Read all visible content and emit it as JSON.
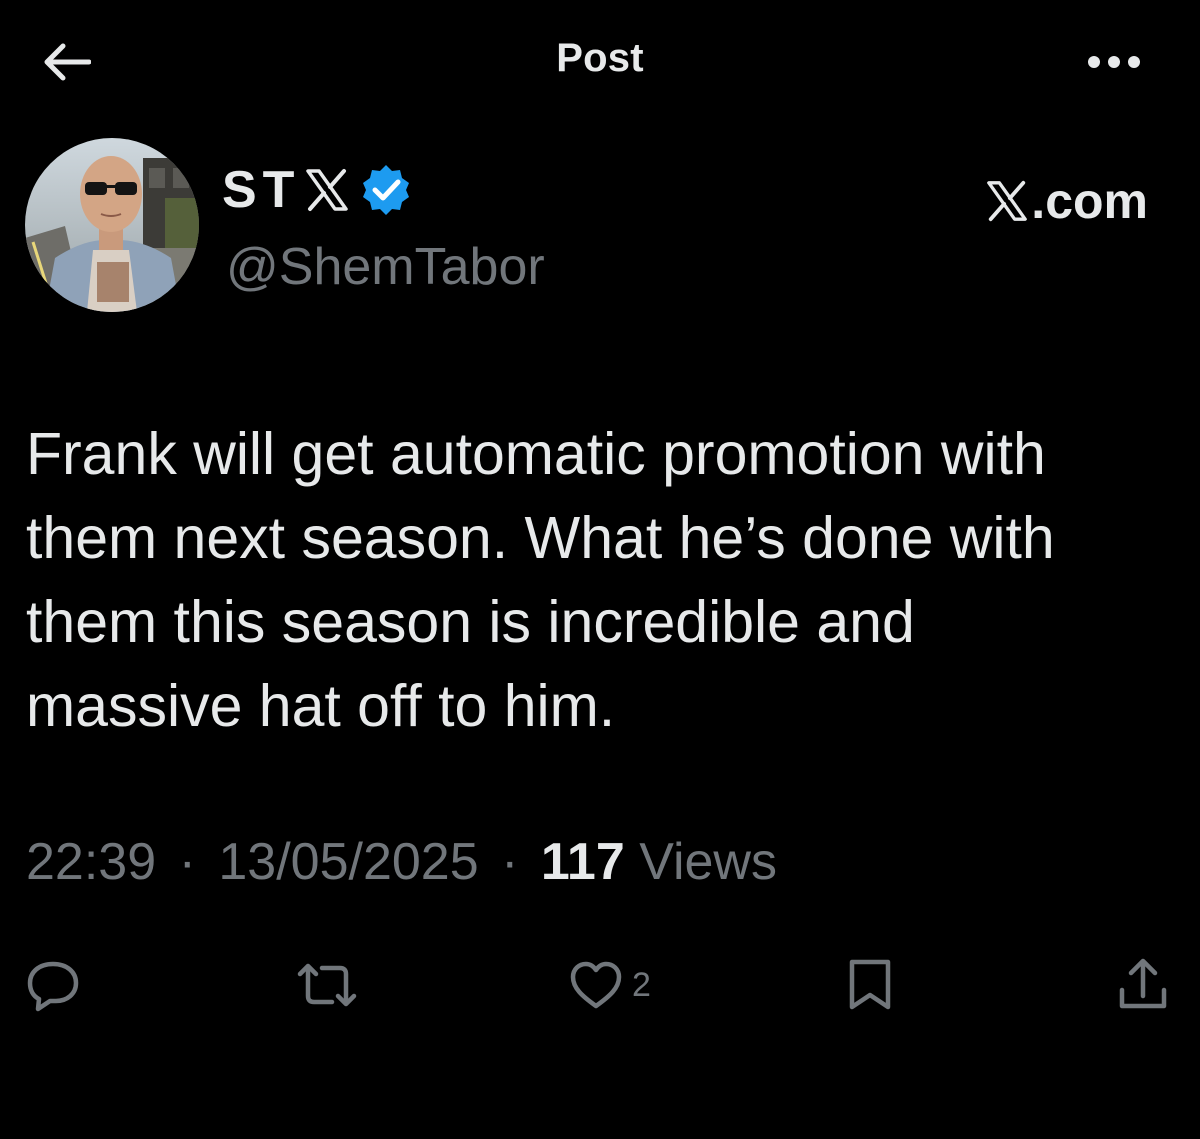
{
  "header": {
    "title": "Post",
    "back_icon": "arrow-left-icon",
    "more_icon": "more-horizontal-icon"
  },
  "author": {
    "display_name": "ST",
    "handle": "@ShemTabor",
    "verified": true,
    "avatar": "profile-photo"
  },
  "site_label": {
    "text": ".com",
    "logo_icon": "x-logo-icon"
  },
  "post": {
    "lines": [
      "Frank will get automatic promotion with",
      "them next season. What he’s done with",
      "them this season is incredible and",
      "massive hat off to him."
    ]
  },
  "meta": {
    "time": "22:39",
    "separator": "·",
    "date": "13/05/2025",
    "views_count": "117",
    "views_label": "Views"
  },
  "actions": {
    "reply_icon": "reply-icon",
    "repost_icon": "repost-icon",
    "like_icon": "heart-icon",
    "like_count": "2",
    "bookmark_icon": "bookmark-icon",
    "share_icon": "share-icon"
  },
  "colors": {
    "background": "#000000",
    "text_primary": "#e7e9ea",
    "text_secondary": "#71767b",
    "verified_blue": "#1d9bf0"
  }
}
